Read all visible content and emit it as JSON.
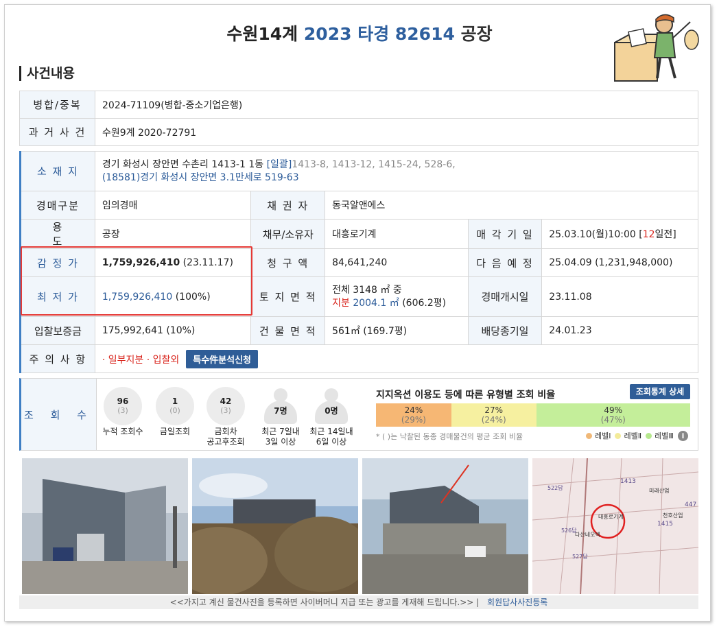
{
  "header": {
    "case_name": "수원14계",
    "case_number": "2023 타경 82614",
    "case_type": "공장",
    "section_title": "사건내용"
  },
  "merge": {
    "label": "병합/중복",
    "value": "2024-71109(병합-중소기업은행)"
  },
  "past_case": {
    "label": "과 거 사 건",
    "value": "수원9계 2020-72791"
  },
  "location": {
    "label": "소 재 지",
    "address": "경기 화성시 장안면 수촌리 1413-1 1동",
    "bundle_link": "[일괄]",
    "bundle_lots": "1413-8, 1413-12, 1415-24, 528-6,",
    "road_address": "(18581)경기 화성시  장안면 3.1만세로  519-63"
  },
  "auction_type": {
    "label": "경매구분",
    "value": "임의경매"
  },
  "creditor": {
    "label": "채 권 자",
    "value": "동국알앤에스"
  },
  "usage": {
    "label": "용 도",
    "value": "공장"
  },
  "debtor": {
    "label": "채무/소유자",
    "value": "대흥로기계"
  },
  "sale_date": {
    "label": "매 각 기 일",
    "value_prefix": "25.03.10(월)10:00 [",
    "days": "12",
    "value_suffix": "일전]"
  },
  "appraisal": {
    "label": "감 정 가",
    "amount": "1,759,926,410",
    "date": "(23.11.17)"
  },
  "claim": {
    "label": "청 구 액",
    "value": "84,641,240"
  },
  "next_schedule": {
    "label": "다 음 예 정",
    "value": "25.04.09 (1,231,948,000)"
  },
  "minimum_price": {
    "label": "최 저 가",
    "amount": "1,759,926,410",
    "pct": "(100%)"
  },
  "land_area": {
    "label": "토 지 면 적",
    "line1": "전체 3148 ㎡ 중",
    "share_label": "지분",
    "share_value": "2004.1 ㎡",
    "share_pyeong": "(606.2평)"
  },
  "auction_start": {
    "label": "경매개시일",
    "value": "23.11.08"
  },
  "deposit": {
    "label": "입찰보증금",
    "value": "175,992,641 (10%)"
  },
  "building_area": {
    "label": "건 물 면 적",
    "value": "561㎡ (169.7평)"
  },
  "dividend_end": {
    "label": "배당종기일",
    "value": "24.01.23"
  },
  "notice": {
    "label": "주 의 사 항",
    "value": "· 일부지분 · 입찰외",
    "button": "특수件분석신청"
  },
  "views": {
    "label": "조 회 수",
    "stats": [
      {
        "num": "96",
        "sub": "(3)",
        "cap1": "누적 조회수",
        "cap2": ""
      },
      {
        "num": "1",
        "sub": "(0)",
        "cap1": "금일조회",
        "cap2": ""
      },
      {
        "num": "42",
        "sub": "(3)",
        "cap1": "금회차",
        "cap2": "공고후조회"
      }
    ],
    "people": [
      {
        "val": "7명",
        "cap1": "최근 7일내",
        "cap2": "3일 이상"
      },
      {
        "val": "0명",
        "cap1": "최근 14일내",
        "cap2": "6일 이상"
      }
    ]
  },
  "ratio": {
    "title": "지지옥션 이용도 등에 따른 유형별 조회 비율",
    "button": "조회통계 상세",
    "segments": [
      {
        "pct": "24%",
        "avg": "(29%)",
        "share": 24,
        "color": "#f6b774"
      },
      {
        "pct": "27%",
        "avg": "(24%)",
        "share": 27,
        "color": "#f6f0a0"
      },
      {
        "pct": "49%",
        "avg": "(47%)",
        "share": 49,
        "color": "#c4ee9a"
      }
    ],
    "note": "* ( )는 낙찰된 동종 경매물건의 평균 조회 비율",
    "legend": [
      {
        "label": "레벨Ⅰ",
        "color": "#f0b878"
      },
      {
        "label": "레벨Ⅱ",
        "color": "#f3eb9a"
      },
      {
        "label": "레벨Ⅲ",
        "color": "#b6e88e"
      }
    ],
    "info": "i"
  },
  "map_labels": {
    "l1": "1413",
    "l2": "대흥로기계",
    "l3": "다산네오텍",
    "l4": "미래산업",
    "l5": "천호산업",
    "l6": "1415",
    "l7": "522답",
    "l8": "526답",
    "l9": "527답",
    "l10": "447"
  },
  "footer": {
    "caption": "<<가지고 계신 물건사진을 등록하면 사이버머니 지급 또는 광고를 게재해 드립니다.>>",
    "separator": "|",
    "link": "회원답사사진등록"
  }
}
